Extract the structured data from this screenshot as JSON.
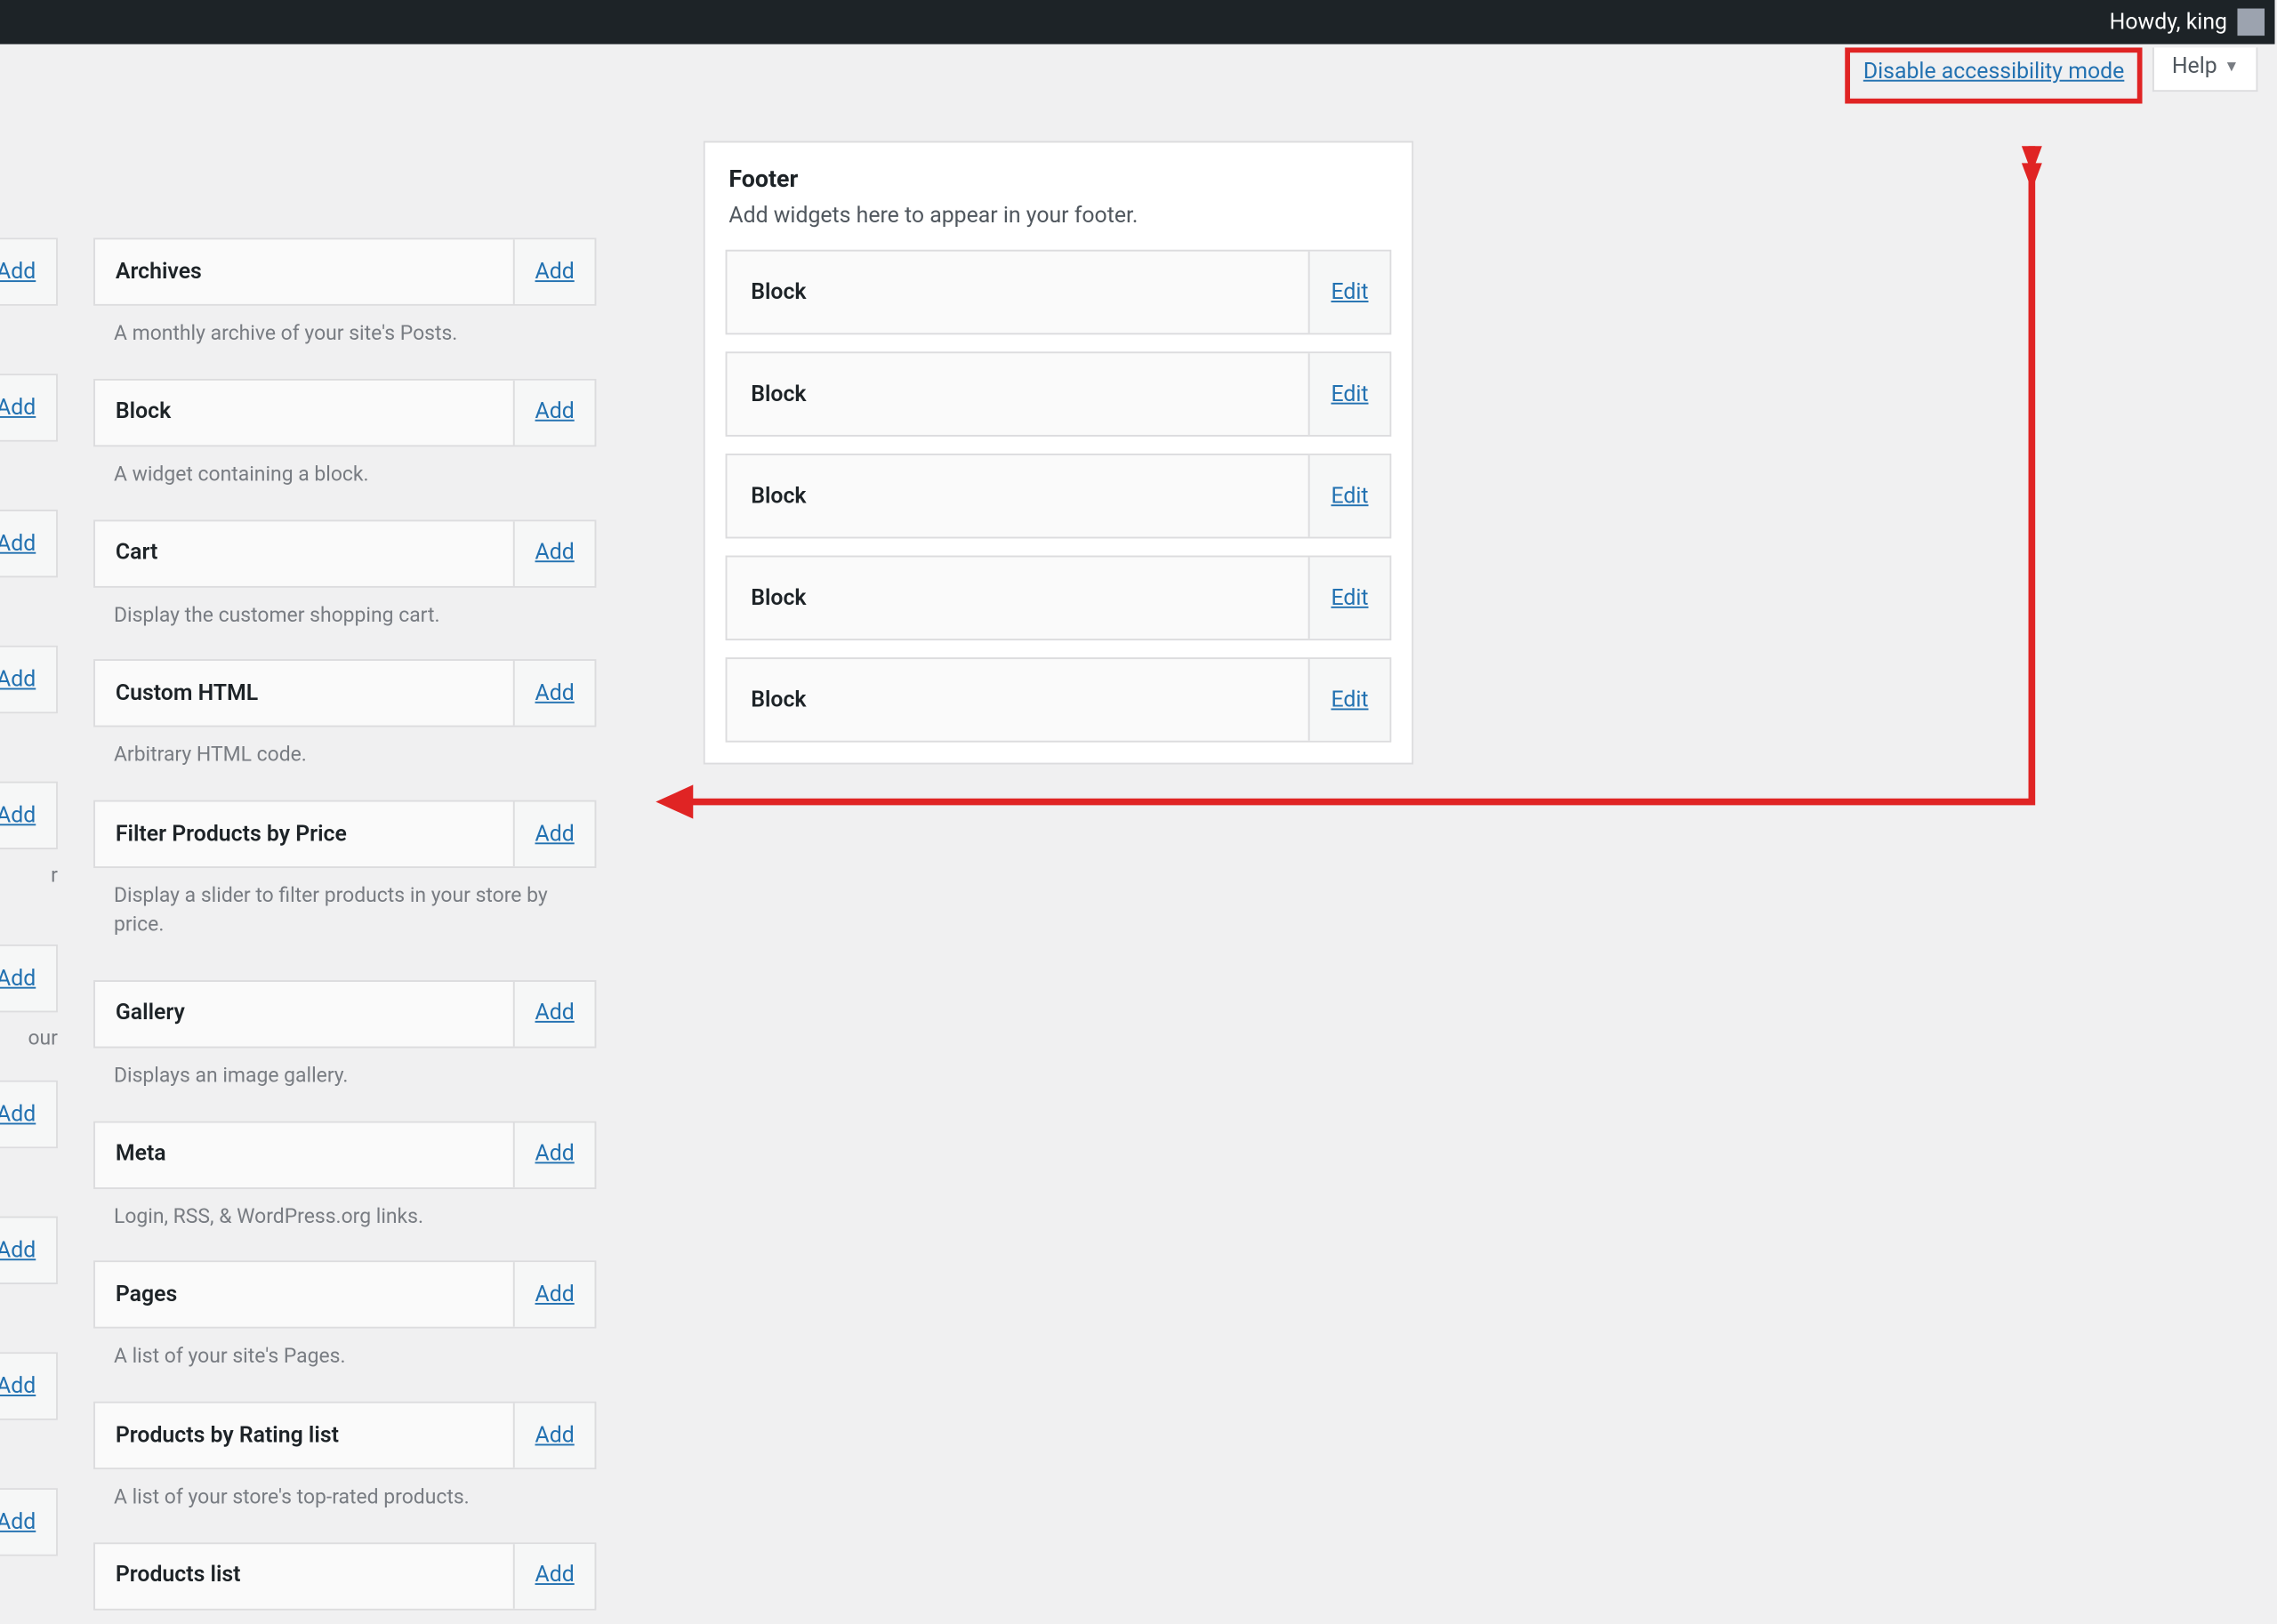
{
  "adminbar": {
    "howdy": "Howdy, king"
  },
  "screen_meta": {
    "accessibility_link": "Disable accessibility mode",
    "help_label": "Help"
  },
  "left_column_fragments": [
    {
      "desc_snippet": ""
    },
    {
      "desc_snippet": ""
    },
    {
      "desc_snippet": ""
    },
    {
      "desc_snippet": ""
    },
    {
      "desc_snippet": "r"
    },
    {
      "desc_snippet": "our"
    },
    {
      "desc_snippet": ""
    },
    {
      "desc_snippet": ""
    },
    {
      "desc_snippet": ""
    },
    {
      "desc_snippet": ""
    }
  ],
  "available_widgets": [
    {
      "title": "Archives",
      "desc": "A monthly archive of your site's Posts."
    },
    {
      "title": "Block",
      "desc": "A widget containing a block."
    },
    {
      "title": "Cart",
      "desc": "Display the customer shopping cart."
    },
    {
      "title": "Custom HTML",
      "desc": "Arbitrary HTML code."
    },
    {
      "title": "Filter Products by Price",
      "desc": "Display a slider to filter products in your store by price."
    },
    {
      "title": "Gallery",
      "desc": "Displays an image gallery."
    },
    {
      "title": "Meta",
      "desc": "Login, RSS, & WordPress.org links."
    },
    {
      "title": "Pages",
      "desc": "A list of your site's Pages."
    },
    {
      "title": "Products by Rating list",
      "desc": "A list of your store's top-rated products."
    },
    {
      "title": "Products list",
      "desc": ""
    }
  ],
  "add_label": "Add",
  "footer_panel": {
    "title": "Footer",
    "desc": "Add widgets here to appear in your footer.",
    "blocks": [
      {
        "title": "Block"
      },
      {
        "title": "Block"
      },
      {
        "title": "Block"
      },
      {
        "title": "Block"
      },
      {
        "title": "Block"
      }
    ],
    "edit_label": "Edit"
  }
}
